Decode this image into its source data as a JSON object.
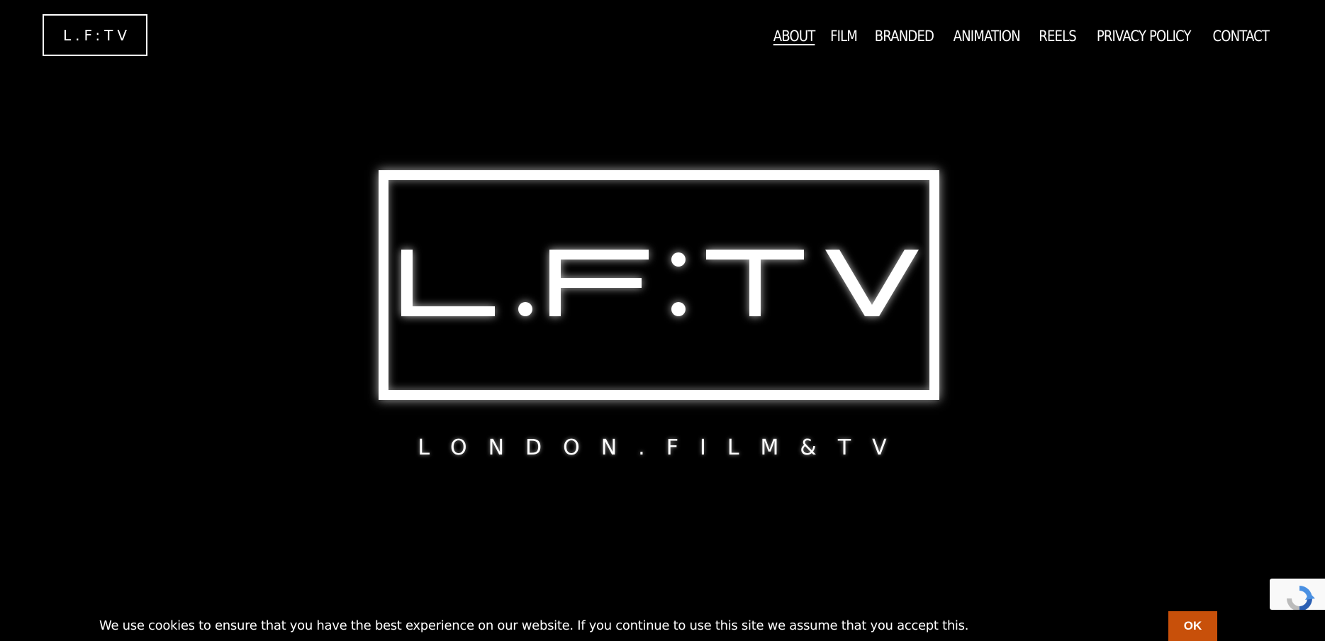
{
  "header": {
    "logo_text": "L.F:TV"
  },
  "nav": {
    "items": [
      {
        "label": "ABOUT",
        "active": true
      },
      {
        "label": "FILM"
      },
      {
        "label": "BRANDED"
      },
      {
        "label": "ANIMATION"
      },
      {
        "label": "REELS"
      },
      {
        "label": "PRIVACY POLICY"
      },
      {
        "label": "CONTACT"
      }
    ]
  },
  "hero": {
    "logo_text": "L.F:TV",
    "tagline": "LONDON.FILM&TV"
  },
  "cookie_bar": {
    "message": "We use cookies to ensure that you have the best experience on our website. If you continue to use this site we assume that you accept this.",
    "ok_label": "OK",
    "ok_color": "#c8500a"
  },
  "recaptcha": {
    "icon": "recaptcha-icon"
  }
}
